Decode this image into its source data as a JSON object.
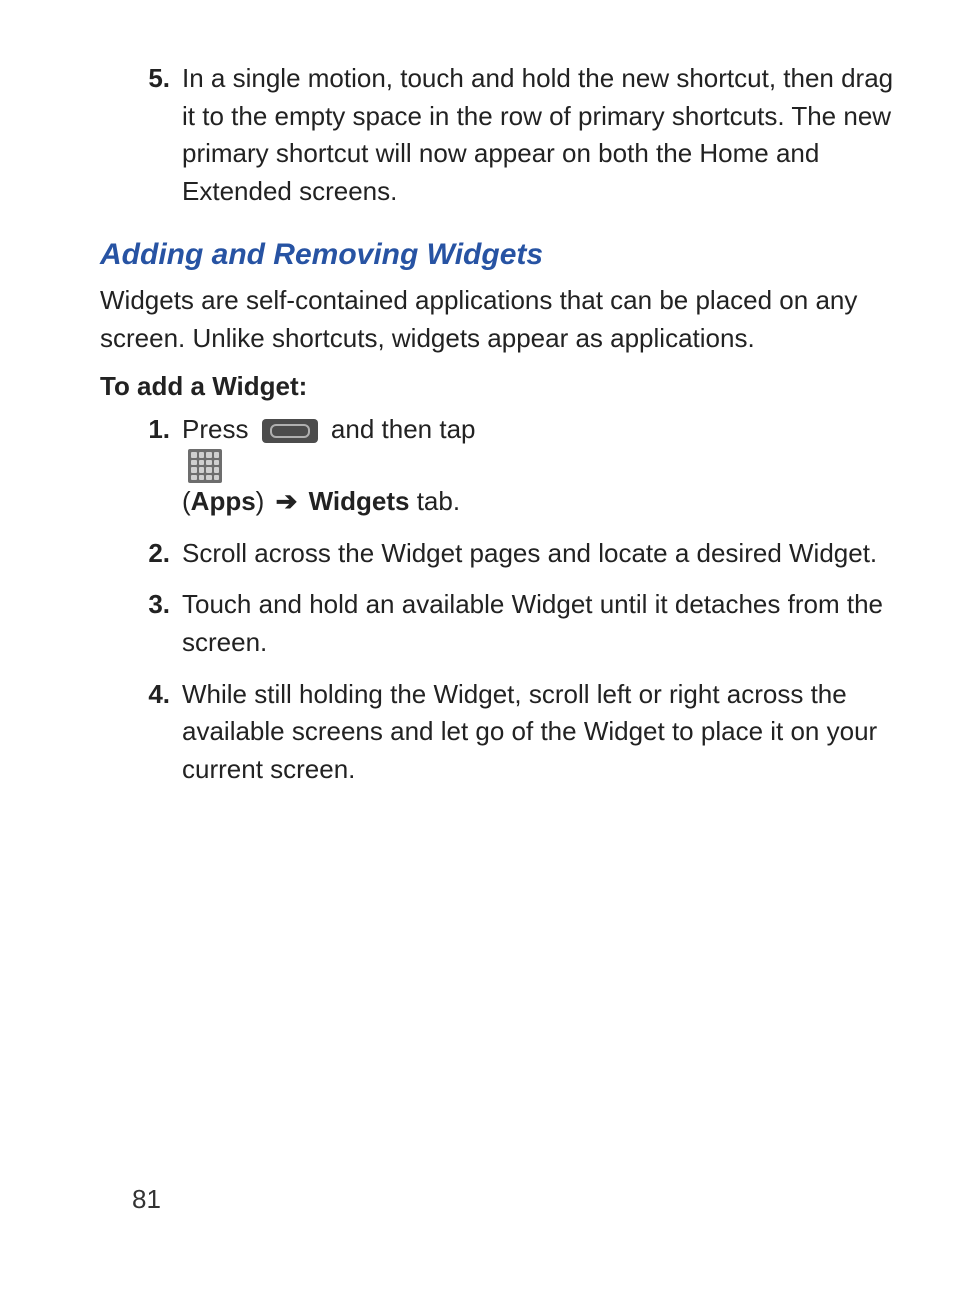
{
  "top_list": {
    "num": "5.",
    "text": "In a single motion, touch and hold the new shortcut, then drag it to the empty space in the row of primary shortcuts. The new primary shortcut will now appear on both the Home and Extended screens."
  },
  "heading": "Adding and Removing Widgets",
  "intro": "Widgets are self-contained applications that can be placed on any screen. Unlike shortcuts, widgets appear as applications.",
  "subheading": "To add a Widget:",
  "step1": {
    "num": "1.",
    "press": "Press ",
    "and_tap": " and then tap ",
    "open_paren": " (",
    "apps": "Apps",
    "close_paren": ") ",
    "arrow": "➔",
    "widgets": " Widgets",
    "tab": " tab."
  },
  "steps": [
    {
      "num": "2.",
      "text": "Scroll across the Widget pages and locate a desired Widget."
    },
    {
      "num": "3.",
      "text": "Touch and hold an available Widget until it detaches from the screen."
    },
    {
      "num": "4.",
      "text": "While still holding the Widget, scroll left or right across the available screens and let go of the Widget to place it on your current screen."
    }
  ],
  "page_number": "81"
}
